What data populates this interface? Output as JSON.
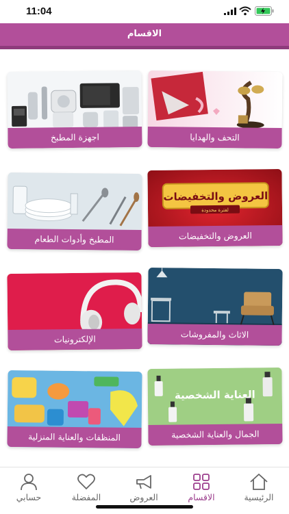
{
  "status_bar": {
    "time": "11:04"
  },
  "header": {
    "title": "الاقسام"
  },
  "categories": [
    {
      "label": "اجهزة المطبخ"
    },
    {
      "label": "التحف والهدايا"
    },
    {
      "label": "المطبخ وأدوات الطعام"
    },
    {
      "label": "العروض والتخفيضات",
      "banner_text": "العروض والتخفيضات",
      "banner_subtext": "لفترة محدودة"
    },
    {
      "label": "الإلكترونيات"
    },
    {
      "label": "الاثاث والمفروشات"
    },
    {
      "label": "المنظفات والعناية المنزلية"
    },
    {
      "label": "الجمال والعناية الشخصية",
      "banner_text": "العناية الشخصية"
    }
  ],
  "tabs": [
    {
      "label": "حسابي",
      "icon": "user-icon"
    },
    {
      "label": "المفضلة",
      "icon": "heart-icon"
    },
    {
      "label": "العروض",
      "icon": "megaphone-icon"
    },
    {
      "label": "الاقسام",
      "icon": "grid-icon",
      "active": true
    },
    {
      "label": "الرئيسية",
      "icon": "home-icon"
    }
  ],
  "colors": {
    "brand": "#b24f9a",
    "brand_dark": "#8e3b7c",
    "active_tab": "#9b3d8c"
  }
}
